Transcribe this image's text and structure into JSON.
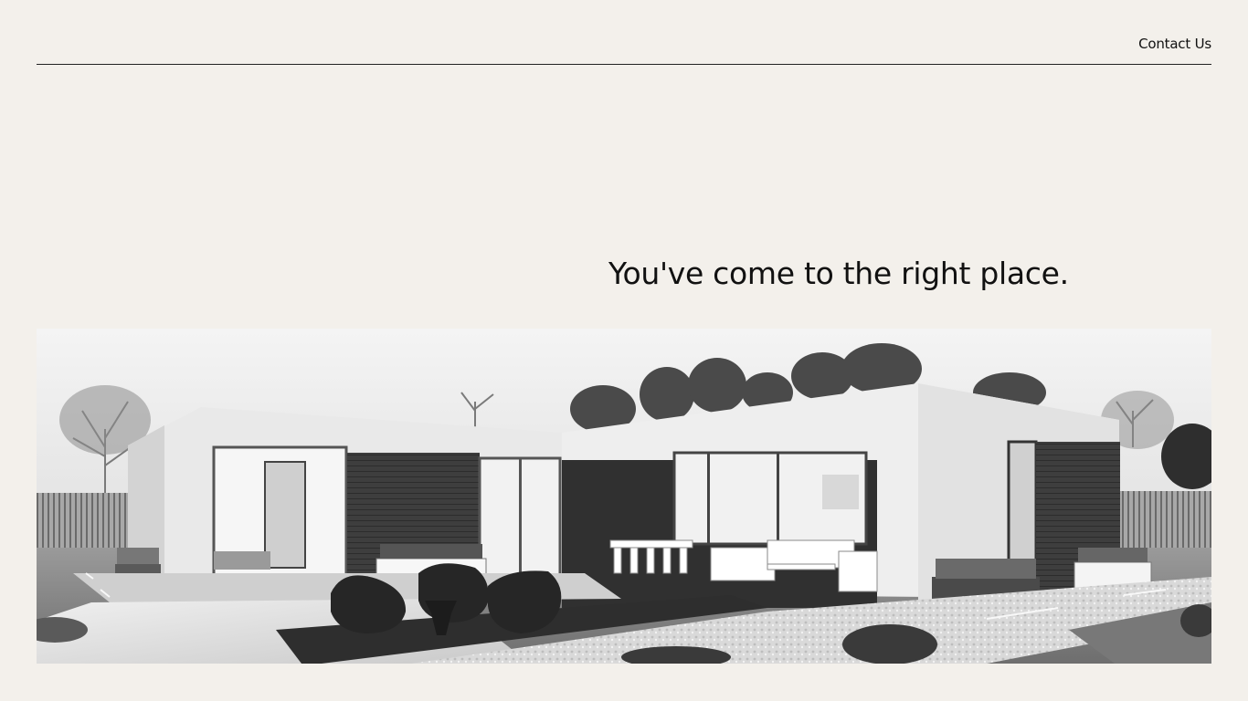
{
  "header": {
    "contact_label": "Contact Us"
  },
  "hero": {
    "headline": "You've come to the right place.",
    "image_subject": "modern-house-grayscale-photo"
  },
  "colors": {
    "background": "#f3f0eb",
    "text": "#111111",
    "divider": "#222222"
  }
}
